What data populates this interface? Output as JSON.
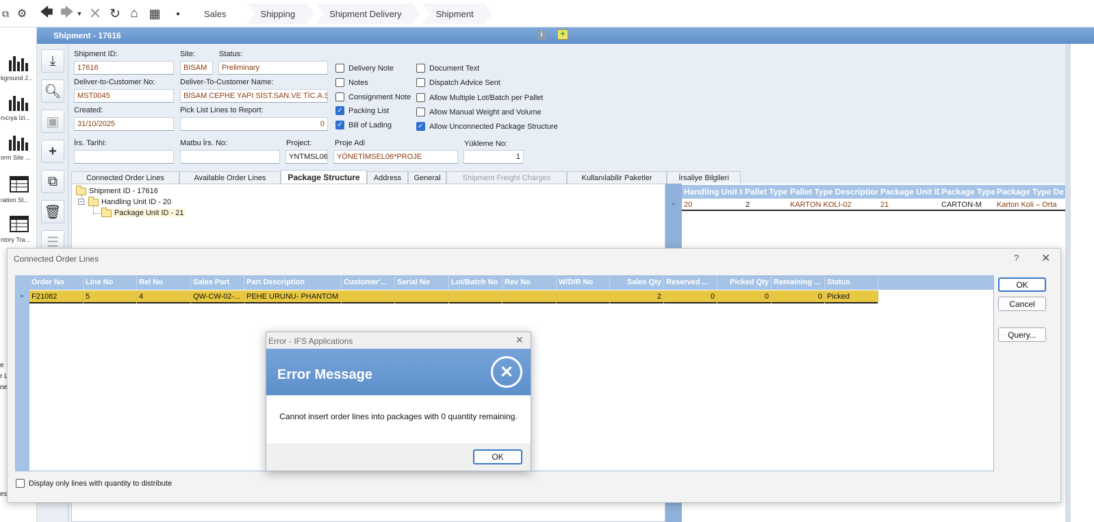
{
  "breadcrumb": [
    "Sales",
    "Shipping",
    "Shipment Delivery",
    "Shipment"
  ],
  "left_nav": [
    {
      "label": "kground J..."
    },
    {
      "label": "nıcıya İzi..."
    },
    {
      "label": "orm Site ..."
    },
    {
      "label": "ration St..."
    },
    {
      "label": "ntory Tra..."
    }
  ],
  "left_nav_stray": [
    "e",
    "r L",
    "ne",
    "es"
  ],
  "window": {
    "title": "Shipment - 17616"
  },
  "form": {
    "shipment_id": {
      "label": "Shipment ID:",
      "value": "17616"
    },
    "site": {
      "label": "Site:",
      "value": "BISAM"
    },
    "status": {
      "label": "Status:",
      "value": "Preliminary"
    },
    "deliver_no": {
      "label": "Deliver-to-Customer No:",
      "value": "MST0045"
    },
    "deliver_name": {
      "label": "Deliver-To-Customer Name:",
      "value": "BİSAM CEPHE YAPI SİST.SAN.VE TİC.A.Ş."
    },
    "created": {
      "label": "Created:",
      "value": "31/10/2025"
    },
    "pick_list": {
      "label": "Pick List Lines to Report:",
      "value": "0"
    },
    "irs_tarihi": {
      "label": "İrs. Tarihi:",
      "value": ""
    },
    "matbu_irs": {
      "label": "Matbu İrs. No:",
      "value": ""
    },
    "project": {
      "label": "Project:",
      "value": "YNTMSL06"
    },
    "proje_adi": {
      "label": "Proje Adi",
      "value": "YÖNETİMSEL06*PROJE"
    },
    "yukleme_no": {
      "label": "Yükleme No:",
      "value": "1"
    }
  },
  "checks_col1": [
    {
      "label": "Delivery Note",
      "checked": false
    },
    {
      "label": "Notes",
      "checked": false
    },
    {
      "label": "Consignment Note",
      "checked": false
    },
    {
      "label": "Packing List",
      "checked": true
    },
    {
      "label": "Bill of Lading",
      "checked": true
    }
  ],
  "checks_col2": [
    {
      "label": "Document Text",
      "checked": false
    },
    {
      "label": "Dispatch Advice Sent",
      "checked": false
    },
    {
      "label": "Allow Multiple Lot/Batch per Pallet",
      "checked": false
    },
    {
      "label": "Allow Manual Weight and Volume",
      "checked": false
    },
    {
      "label": "Allow Unconnected Package Structure",
      "checked": true
    }
  ],
  "tabs": [
    {
      "label": "Connected Order Lines"
    },
    {
      "label": "Available Order Lines"
    },
    {
      "label": "Package Structure"
    },
    {
      "label": "Address"
    },
    {
      "label": "General"
    },
    {
      "label": "Shipment Freight Charges"
    },
    {
      "label": "Kullanılabilir Paketler"
    },
    {
      "label": "İrsaliye Bilgileri"
    }
  ],
  "tree": {
    "root": "Shipment ID - 17616",
    "child": "Handling Unit ID - 20",
    "grandchild": "Package Unit ID - 21"
  },
  "package_grid": {
    "headers": [
      "Handling Unit ID",
      "Pallet Type",
      "Pallet Type Description",
      "Package Unit ID",
      "Package Type",
      "Package Type Des"
    ],
    "row": [
      "20",
      "2",
      "KARTON KOLİ-02",
      "21",
      "CARTON-M",
      "Karton Koli – Orta"
    ]
  },
  "order_dialog": {
    "title": "Connected Order Lines",
    "help": "?",
    "headers": [
      "Order No",
      "Line No",
      "Rel No",
      "Sales Part",
      "Part Description",
      "Customer'...",
      "Serial No",
      "Lot/Batch No",
      "Rev No",
      "W/D/R No",
      "Sales Qty",
      "Reserved ...",
      "Picked Qty",
      "Remaining ...",
      "Status"
    ],
    "row": [
      "F21082",
      "5",
      "4",
      "QW-CW-02-...",
      "PEHE URUNU- PHANTOM ...",
      "",
      "",
      "",
      "",
      "",
      "2",
      "0",
      "0",
      "0",
      "Picked"
    ],
    "ok": "OK",
    "cancel": "Cancel",
    "query": "Query...",
    "display_only": "Display only lines with quantity to distribute"
  },
  "error_dialog": {
    "title": "Error - IFS Applications",
    "heading": "Error Message",
    "message": "Cannot insert order lines into packages with 0 quantity remaining.",
    "ok": "OK"
  },
  "colors": {
    "accent": "#5e8fcb",
    "header": "#a5c3e6",
    "row_highlight": "#e8c840",
    "value_text": "#8b3a0d"
  }
}
